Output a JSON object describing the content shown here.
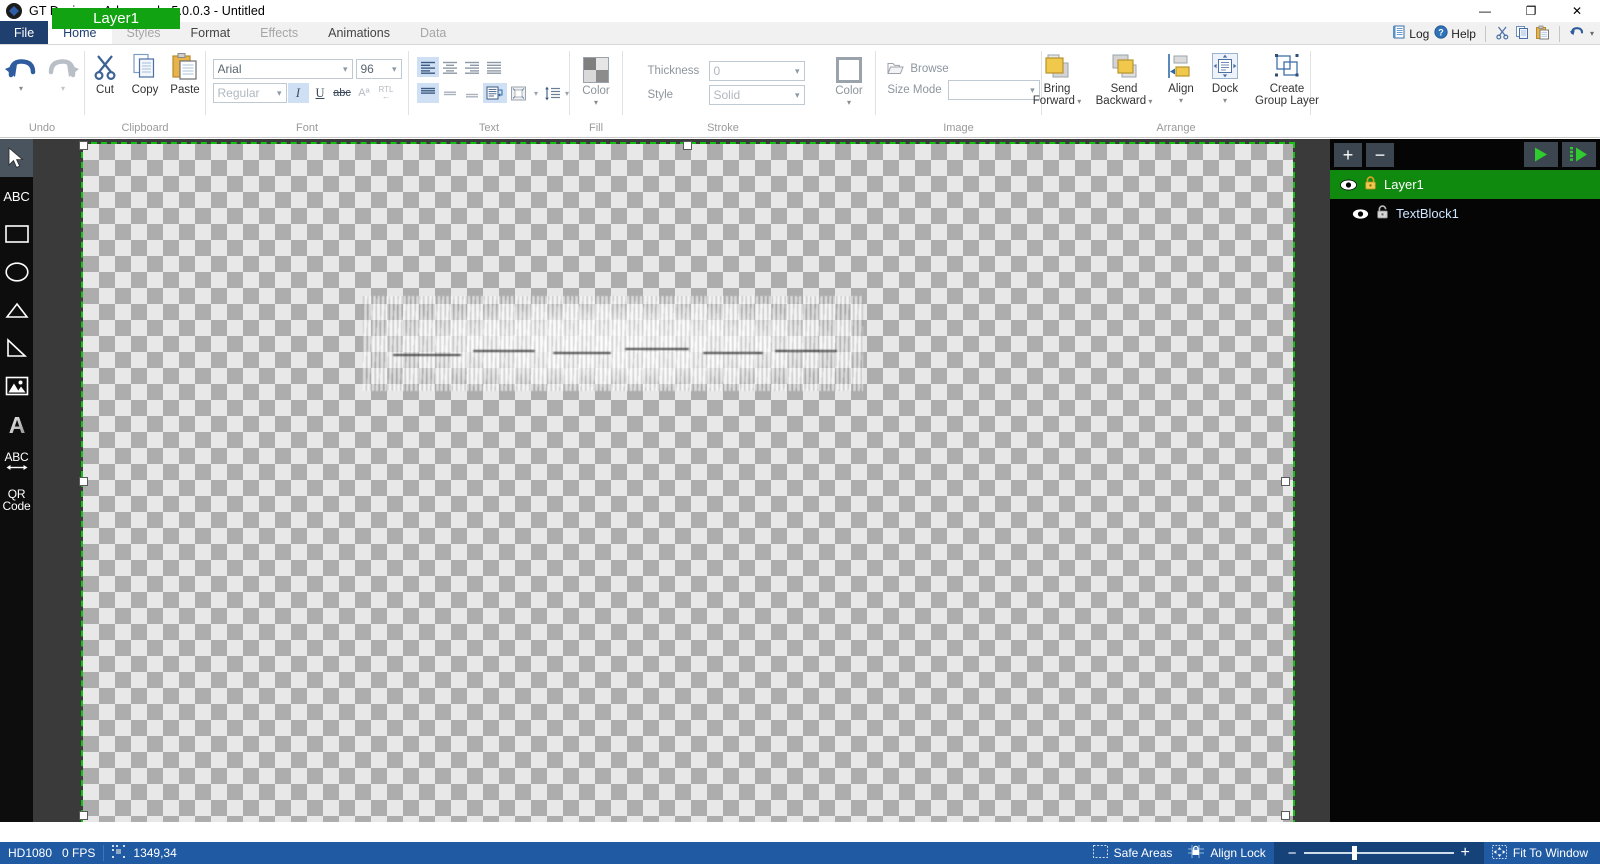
{
  "window": {
    "title": "GT Designer Advanced - 5.0.0.3 - Untitled",
    "app_icon": "gt-designer-icon",
    "minimize_label": "—",
    "maximize_label": "❐",
    "close_label": "✕"
  },
  "tabs": [
    {
      "label": "File",
      "state": "file"
    },
    {
      "label": "Home",
      "state": "active"
    },
    {
      "label": "Styles",
      "state": "dim"
    },
    {
      "label": "Format",
      "state": "normal"
    },
    {
      "label": "Effects",
      "state": "dim"
    },
    {
      "label": "Animations",
      "state": "normal"
    },
    {
      "label": "Data",
      "state": "dim"
    }
  ],
  "quick_access": {
    "log_label": "Log",
    "help_label": "Help",
    "cut_icon": "scissors-icon",
    "copy_icon": "copy-icon",
    "paste_icon": "paste-icon",
    "undo_icon": "undo-arrow-icon",
    "undo_caret": "▾"
  },
  "ribbon": {
    "groups": {
      "undo": {
        "label": "Undo",
        "undo_button": "undo-arrow",
        "redo_button": "redo-arrow",
        "caret": "▾"
      },
      "clipboard": {
        "label": "Clipboard",
        "cut_label": "Cut",
        "copy_label": "Copy",
        "paste_label": "Paste"
      },
      "font": {
        "label": "Font",
        "family_value": "Arial",
        "size_value": "96",
        "style_value": "Regular",
        "italic_label": "I",
        "underline_label": "U",
        "strike_label": "abc",
        "superscript_label": "Aª",
        "rtl_label": "RTL"
      },
      "text": {
        "label": "Text",
        "align_left": "align-left",
        "align_center": "align-center",
        "align_right": "align-right",
        "align_justify": "align-justify",
        "valign_top": "valign-top",
        "valign_middle": "valign-middle",
        "valign_bottom": "valign-bottom",
        "wrap": "text-wrap",
        "margins": "text-margins",
        "line_spacing": "line-spacing"
      },
      "fill": {
        "label": "Fill",
        "color_label": "Color",
        "caret": "▾"
      },
      "stroke": {
        "label": "Stroke",
        "thickness_label": "Thickness",
        "thickness_value": "0",
        "style_label": "Style",
        "style_value": "Solid",
        "color_label": "Color",
        "caret": "▾"
      },
      "image": {
        "label": "Image",
        "browse_label": "Browse",
        "size_mode_label": "Size Mode",
        "size_mode_value": ""
      },
      "arrange": {
        "label": "Arrange",
        "bring_forward_line1": "Bring",
        "bring_forward_line2": "Forward",
        "send_backward_line1": "Send",
        "send_backward_line2": "Backward",
        "align_label": "Align",
        "dock_label": "Dock",
        "create_group_line1": "Create",
        "create_group_line2": "Group Layer",
        "caret": "▾"
      }
    }
  },
  "left_toolbar": {
    "tools": [
      {
        "name": "select-tool",
        "glyph": "arrow",
        "selected": true
      },
      {
        "name": "text-tool",
        "glyph": "ABC",
        "selected": false
      },
      {
        "name": "rectangle-tool",
        "glyph": "rect",
        "selected": false
      },
      {
        "name": "ellipse-tool",
        "glyph": "ellipse",
        "selected": false
      },
      {
        "name": "triangle-tool",
        "glyph": "triangle",
        "selected": false
      },
      {
        "name": "right-triangle-tool",
        "glyph": "rtriangle",
        "selected": false
      },
      {
        "name": "image-tool",
        "glyph": "image",
        "selected": false
      },
      {
        "name": "gradient-text-tool",
        "glyph": "A",
        "selected": false
      },
      {
        "name": "scrolling-text-tool",
        "glyph": "ABC-arrow",
        "selected": false
      },
      {
        "name": "qr-code-tool",
        "glyph": "QR Code",
        "selected": false
      }
    ],
    "qr_line1": "QR",
    "qr_line2": "Code",
    "abc_label": "ABC",
    "text_label": "ABC"
  },
  "canvas": {
    "layer_tag": "Layer1",
    "redacted_note": "blurred-text-object"
  },
  "layers_panel": {
    "add_label": "+",
    "remove_label": "−",
    "play_icon": "play-icon",
    "play_all_icon": "play-all-icon",
    "items": [
      {
        "name": "Layer1",
        "selected": true,
        "locked": true,
        "visible": true,
        "indent": 0
      },
      {
        "name": "TextBlock1",
        "selected": false,
        "locked": false,
        "visible": true,
        "indent": 1
      }
    ]
  },
  "status_bar": {
    "resolution": "HD1080",
    "fps": "0 FPS",
    "coordinates": "1349,34",
    "safe_areas_label": "Safe Areas",
    "align_lock_label": "Align Lock",
    "zoom_minus": "−",
    "zoom_plus": "+",
    "fit_label": "Fit To Window"
  },
  "colors": {
    "accent_blue": "#1f5aa3",
    "file_tab_blue": "#1f3f6e",
    "layer_green": "#0f8a0f",
    "canvas_bg": "#3a3a3a",
    "panel_black": "#050505",
    "selection_blue": "#cfe0f5"
  }
}
